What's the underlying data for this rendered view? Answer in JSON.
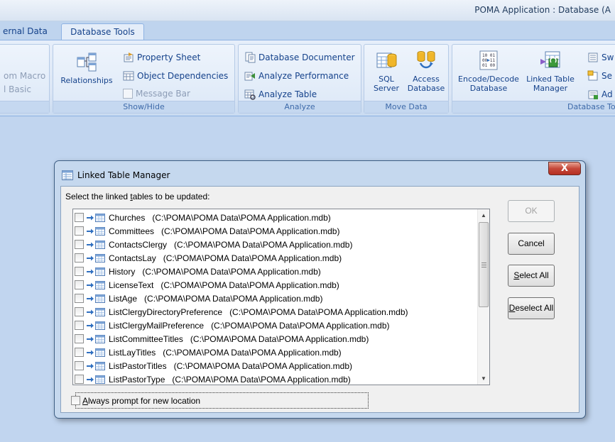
{
  "window": {
    "title": "POMA Application : Database (A"
  },
  "ribbon": {
    "tabs": [
      {
        "label": "ernal Data",
        "active": false
      },
      {
        "label": "Database Tools",
        "active": true
      }
    ],
    "macro": {
      "items": [
        "om Macro",
        "l Basic"
      ]
    },
    "show_hide": {
      "label": "Show/Hide",
      "relationships": "Relationships",
      "property_sheet": "Property Sheet",
      "object_dependencies": "Object Dependencies",
      "message_bar": "Message Bar"
    },
    "analyze": {
      "label": "Analyze",
      "database_documenter": "Database Documenter",
      "analyze_performance": "Analyze Performance",
      "analyze_table": "Analyze Table"
    },
    "move_data": {
      "label": "Move Data",
      "sql_server_1": "SQL",
      "sql_server_2": "Server",
      "access_db_1": "Access",
      "access_db_2": "Database"
    },
    "database_tools": {
      "label": "Database To",
      "encode_1": "Encode/Decode",
      "encode_2": "Database",
      "linked_1": "Linked Table",
      "linked_2": "Manager",
      "sw": "Sw",
      "se": "Se",
      "ad": "Ad"
    }
  },
  "dialog": {
    "title": "Linked Table Manager",
    "close_glyph": "X",
    "instruction_pre": "Select the linked ",
    "instruction_accel": "t",
    "instruction_post": "ables to be updated:",
    "tables": [
      {
        "name": "Churches",
        "path": "(C:\\POMA\\POMA Data\\POMA Application.mdb)",
        "checked": false
      },
      {
        "name": "Committees",
        "path": "(C:\\POMA\\POMA Data\\POMA Application.mdb)",
        "checked": false
      },
      {
        "name": "ContactsClergy",
        "path": "(C:\\POMA\\POMA Data\\POMA Application.mdb)",
        "checked": false
      },
      {
        "name": "ContactsLay",
        "path": "(C:\\POMA\\POMA Data\\POMA Application.mdb)",
        "checked": false
      },
      {
        "name": "History",
        "path": "(C:\\POMA\\POMA Data\\POMA Application.mdb)",
        "checked": false
      },
      {
        "name": "LicenseText",
        "path": "(C:\\POMA\\POMA Data\\POMA Application.mdb)",
        "checked": false
      },
      {
        "name": "ListAge",
        "path": "(C:\\POMA\\POMA Data\\POMA Application.mdb)",
        "checked": false
      },
      {
        "name": "ListClergyDirectoryPreference",
        "path": "(C:\\POMA\\POMA Data\\POMA Application.mdb)",
        "checked": false
      },
      {
        "name": "ListClergyMailPreference",
        "path": "(C:\\POMA\\POMA Data\\POMA Application.mdb)",
        "checked": false
      },
      {
        "name": "ListCommitteeTitles",
        "path": "(C:\\POMA\\POMA Data\\POMA Application.mdb)",
        "checked": false
      },
      {
        "name": "ListLayTitles",
        "path": "(C:\\POMA\\POMA Data\\POMA Application.mdb)",
        "checked": false
      },
      {
        "name": "ListPastorTitles",
        "path": "(C:\\POMA\\POMA Data\\POMA Application.mdb)",
        "checked": false
      },
      {
        "name": "ListPastorType",
        "path": "(C:\\POMA\\POMA Data\\POMA Application.mdb)",
        "checked": false
      }
    ],
    "buttons": {
      "ok": "OK",
      "cancel": "Cancel",
      "select_all_accel": "S",
      "select_all_rest": "elect All",
      "deselect_all_accel": "D",
      "deselect_all_rest": "eselect All"
    },
    "always_prompt_accel": "A",
    "always_prompt_rest": "lways prompt for new location",
    "always_prompt_checked": false
  },
  "colors": {
    "ribbon_text": "#15428b",
    "workspace": "#c1d5ef",
    "close_button": "#c6483a"
  }
}
